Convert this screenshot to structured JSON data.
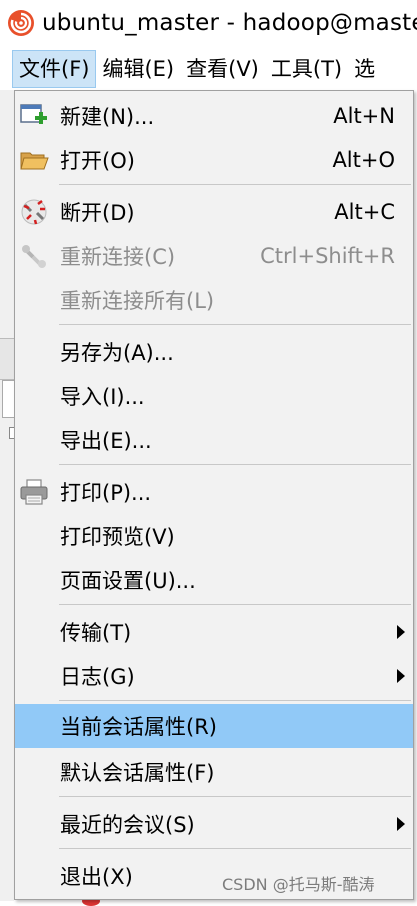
{
  "window": {
    "title": "ubuntu_master - hadoop@maste"
  },
  "menubar": {
    "items": [
      {
        "label": "文件(F)"
      },
      {
        "label": "编辑(E)"
      },
      {
        "label": "查看(V)"
      },
      {
        "label": "工具(T)"
      },
      {
        "label": "选"
      }
    ]
  },
  "file_menu": {
    "new": {
      "label": "新建(N)...",
      "shortcut": "Alt+N",
      "icon": "new-session-icon"
    },
    "open": {
      "label": "打开(O)",
      "shortcut": "Alt+O",
      "icon": "folder-open-icon"
    },
    "disconnect": {
      "label": "断开(D)",
      "shortcut": "Alt+C",
      "icon": "disconnect-icon"
    },
    "reconnect": {
      "label": "重新连接(C)",
      "shortcut": "Ctrl+Shift+R",
      "icon": "reconnect-icon"
    },
    "reconnect_all": {
      "label": "重新连接所有(L)"
    },
    "save_as": {
      "label": "另存为(A)..."
    },
    "import": {
      "label": "导入(I)..."
    },
    "export": {
      "label": "导出(E)..."
    },
    "print": {
      "label": "打印(P)...",
      "icon": "printer-icon"
    },
    "print_preview": {
      "label": "打印预览(V)"
    },
    "page_setup": {
      "label": "页面设置(U)..."
    },
    "transfer": {
      "label": "传输(T)"
    },
    "log": {
      "label": "日志(G)"
    },
    "current_session_props": {
      "label": "当前会话属性(R)"
    },
    "default_session_props": {
      "label": "默认会话属性(F)"
    },
    "recent_sessions": {
      "label": "最近的会议(S)"
    },
    "exit": {
      "label": "退出(X)"
    }
  },
  "watermark": "CSDN @托马斯-酷涛",
  "colors": {
    "highlight": "#91c9f7",
    "menu_bg": "#f2f2f2",
    "disabled_text": "#8d8d8d",
    "active_menubar": "#cce4f7"
  }
}
